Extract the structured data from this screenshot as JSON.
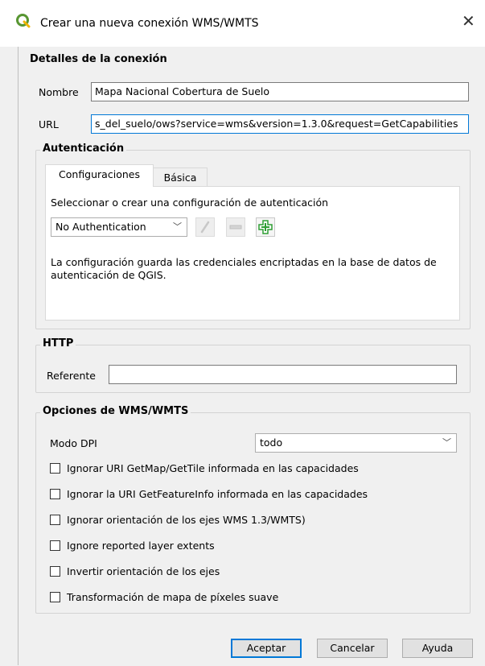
{
  "window": {
    "title": "Crear una nueva conexión WMS/WMTS",
    "close_glyph": "✕",
    "icon": "qgis-logo-icon"
  },
  "connection_details": {
    "group_title": "Detalles de la conexión",
    "name_label": "Nombre",
    "name_value": "Mapa Nacional Cobertura de Suelo",
    "url_label": "URL",
    "url_value": "s_del_suelo/ows?service=wms&version=1.3.0&request=GetCapabilities"
  },
  "authentication": {
    "group_title": "Autenticación",
    "tabs": [
      {
        "label": "Configuraciones",
        "active": true
      },
      {
        "label": "Básica",
        "active": false
      }
    ],
    "select_label": "Seleccionar o crear una configuración de autenticación",
    "selected_config": "No Authentication",
    "icons": [
      "edit-pencil-icon",
      "remove-icon",
      "add-plus-icon"
    ],
    "info_text": "La configuración guarda las credenciales encriptadas en la base de datos de autenticación de QGIS."
  },
  "http": {
    "group_title": "HTTP",
    "referer_label": "Referente",
    "referer_value": ""
  },
  "wms_options": {
    "group_title": "Opciones de WMS/WMTS",
    "dpi_label": "Modo DPI",
    "dpi_value": "todo",
    "checkboxes": [
      {
        "label": "Ignorar URI GetMap/GetTile informada en las capacidades",
        "checked": false
      },
      {
        "label": "Ignorar la URI GetFeatureInfo informada en las capacidades",
        "checked": false
      },
      {
        "label": "Ignorar orientación de los ejes WMS 1.3/WMTS)",
        "checked": false
      },
      {
        "label": "Ignore reported layer extents",
        "checked": false
      },
      {
        "label": "Invertir orientación de los ejes",
        "checked": false
      },
      {
        "label": "Transformación de mapa de píxeles suave",
        "checked": false
      }
    ]
  },
  "buttons": {
    "ok": "Aceptar",
    "cancel": "Cancelar",
    "help": "Ayuda"
  },
  "colors": {
    "accent": "#0078d7",
    "background": "#f0f0f0",
    "qgis_green": "#589632",
    "add_icon_green": "#2e9e34"
  }
}
